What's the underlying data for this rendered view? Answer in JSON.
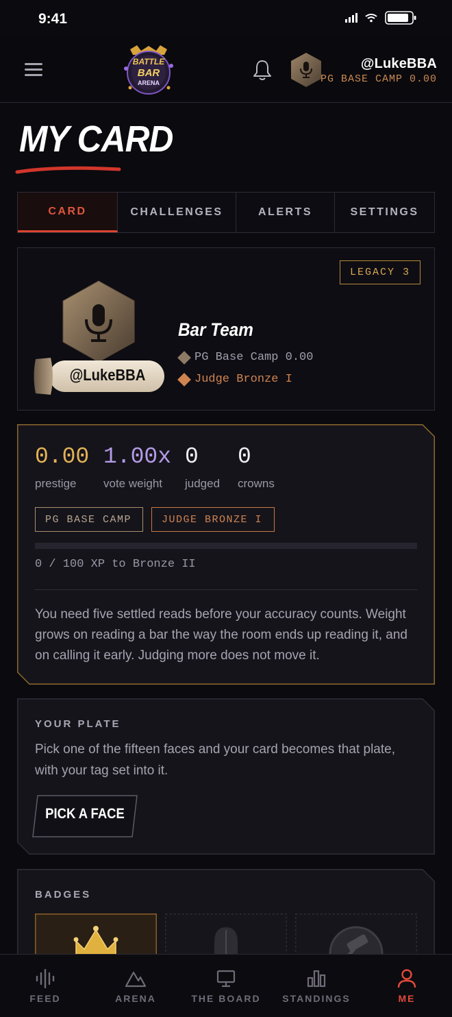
{
  "status_bar": {
    "time": "9:41"
  },
  "header": {
    "logo_text": [
      "BATTLE",
      "BAR",
      "ARENA"
    ],
    "user_handle": "@LukeBBA",
    "user_rank": "PG BASE CAMP 0.00"
  },
  "page": {
    "title": "MY CARD"
  },
  "tabs": [
    {
      "label": "CARD",
      "active": true
    },
    {
      "label": "CHALLENGES",
      "active": false
    },
    {
      "label": "ALERTS",
      "active": false
    },
    {
      "label": "SETTINGS",
      "active": false
    }
  ],
  "card": {
    "legacy": "LEGACY 3",
    "handle": "@LukeBBA",
    "team": "Bar Team",
    "rank_line": "PG Base Camp 0.00",
    "judge_line": "Judge Bronze I"
  },
  "stats": {
    "prestige": {
      "value": "0.00",
      "label": "prestige"
    },
    "vote_weight": {
      "value": "1.00x",
      "label": "vote weight"
    },
    "judged": {
      "value": "0",
      "label": "judged"
    },
    "crowns": {
      "value": "0",
      "label": "crowns"
    },
    "chips": [
      "PG BASE CAMP",
      "JUDGE BRONZE I"
    ],
    "xp_progress": 0,
    "xp_text": "0 / 100 XP to Bronze II",
    "explanation": "You need five settled reads before your accuracy counts. Weight grows on reading a bar the way the room ends up reading it, and on calling it early. Judging more does not move it."
  },
  "plate": {
    "heading": "YOUR PLATE",
    "text": "Pick one of the fifteen faces and your card becomes that plate, with your tag set into it.",
    "button": "PICK A FACE"
  },
  "badges": {
    "heading": "BADGES"
  },
  "bottom_nav": [
    {
      "label": "FEED",
      "icon": "waveform-icon",
      "active": false
    },
    {
      "label": "ARENA",
      "icon": "mountain-icon",
      "active": false
    },
    {
      "label": "THE BOARD",
      "icon": "monitor-icon",
      "active": false
    },
    {
      "label": "STANDINGS",
      "icon": "bar-chart-icon",
      "active": false
    },
    {
      "label": "ME",
      "icon": "user-icon",
      "active": true
    }
  ],
  "colors": {
    "accent_red": "#d94532",
    "gold": "#d7a752",
    "bronze": "#d08450",
    "violet": "#b49be6"
  }
}
